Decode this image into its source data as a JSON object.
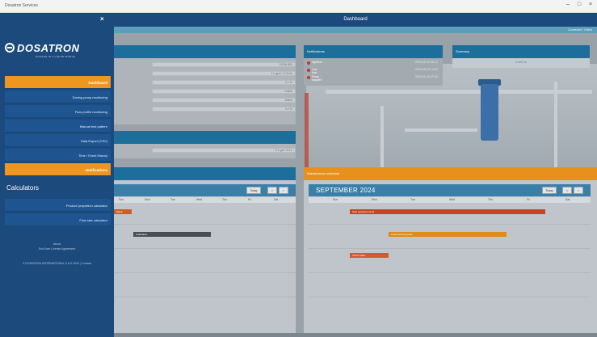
{
  "window": {
    "title": "Dosatron Services",
    "controls": {
      "minimize": "–",
      "maximize": "□",
      "close": "×"
    }
  },
  "sidebar": {
    "close_icon": "×",
    "logo": {
      "brand": "DOSATRON",
      "tagline": "DOSAGE IN A LIQUID WORLD"
    },
    "items": [
      {
        "label": "Dashboard",
        "active": true
      },
      {
        "label": "Dosing pump monitoring",
        "active": false
      },
      {
        "label": "Flow profile monitoring",
        "active": false
      },
      {
        "label": "Manual test pattern",
        "active": false
      },
      {
        "label": "Data Export (CSV)",
        "active": false
      },
      {
        "label": "Time / Event History",
        "active": false
      },
      {
        "label": "Notifications",
        "active": true
      }
    ],
    "section_title": "Calculators",
    "calculators": [
      {
        "label": "Product proportion calculator"
      },
      {
        "label": "Flow rate calculator"
      }
    ],
    "footer": {
      "line1": "About",
      "line2": "End User License Agreement",
      "line3": "© DOSATRON INTERNATIONAL S.A.S 2024 | Contact"
    }
  },
  "header": {
    "title": "Dashboard",
    "subtitle": "Connected / Online"
  },
  "panels": {
    "device_info": {
      "title": "",
      "rows": [
        "D2D8 (50)",
        "1.1 gpm / 0.04 l/s",
        "2.1 %",
        "Online",
        "Active",
        "0.2 %"
      ]
    },
    "consumption": {
      "title": "",
      "value": "0.1 gal / 0.3 L"
    },
    "alarms": {
      "title": "Notifications",
      "items": [
        {
          "label": "Injection",
          "value": "2024-09-12 08:14"
        },
        {
          "label": "Low flow",
          "value": "2024-09-13 10:22"
        },
        {
          "label": "Pump stopped",
          "value": "2024-09-16 07:05"
        }
      ]
    },
    "summary": {
      "title": "Summary",
      "value": "0.000 m³"
    },
    "maintenance": {
      "title": "Maintenance schedule"
    }
  },
  "calendars": {
    "left": {
      "month": "",
      "buttons": [
        "Today",
        "<",
        ">"
      ],
      "dow": [
        "Sun",
        "Mon",
        "Tue",
        "Wed",
        "Thu",
        "Fri",
        "Sat"
      ],
      "events": [
        {
          "label": "Maint.",
          "color": "#d35a2b"
        },
        {
          "label": "Calibration",
          "color": "#4a4d52"
        }
      ]
    },
    "right": {
      "month": "SEPTEMBER 2024",
      "buttons": [
        "Today",
        "<",
        ">"
      ],
      "dow": [
        "Sun",
        "Mon",
        "Tue",
        "Wed",
        "Thu",
        "Fri",
        "Sat"
      ],
      "events": [
        {
          "label": "Seal replacement kit",
          "color": "#c8441f"
        },
        {
          "label": "Check dosing piston",
          "color": "#e08a1a"
        },
        {
          "label": "Check valve",
          "color": "#d35a2b"
        }
      ]
    }
  },
  "colors": {
    "sidebar": "#1c4a7c",
    "accent": "#f0961e",
    "panel_header": "#1b6f9a",
    "overlay": "#9aa2a9"
  }
}
